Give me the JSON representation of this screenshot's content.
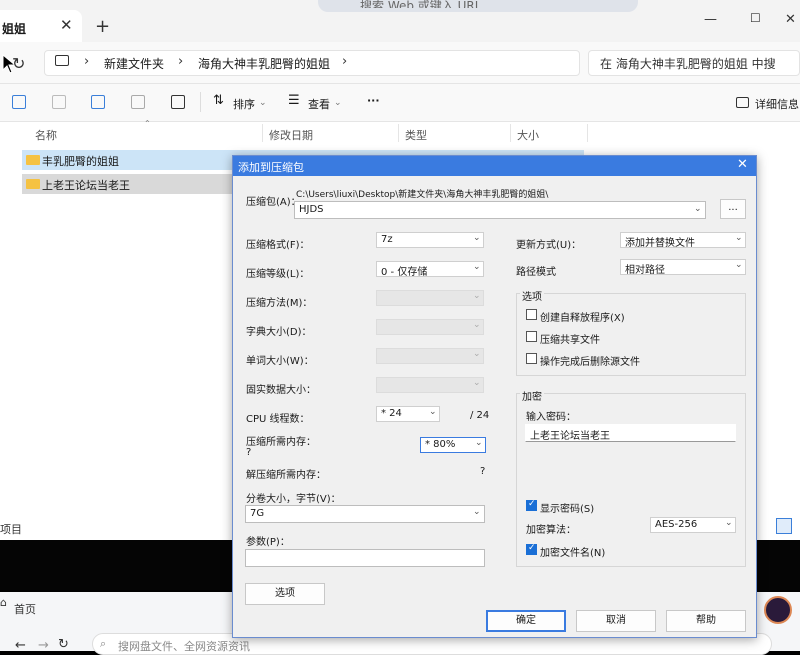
{
  "explorer": {
    "tab_title": "姐姐",
    "close_glyph": "✕",
    "new_tab_glyph": "+",
    "browser_search_placeholder": "搜索 Web 或键入 URL",
    "breadcrumb": [
      "新建文件夹",
      "海角大神丰乳肥臀的姐姐"
    ],
    "search_placeholder": "在 海角大神丰乳肥臀的姐姐 中搜",
    "toolbar": {
      "sort": "排序",
      "view": "查看",
      "more": "···",
      "details": "详细信息"
    },
    "columns": [
      "名称",
      "修改日期",
      "类型",
      "大小"
    ],
    "rows": [
      "丰乳肥臀的姐姐",
      "上老王论坛当老王"
    ],
    "status": "项目"
  },
  "browser": {
    "home_tab": "首页",
    "address_placeholder": "搜网盘文件、全网资源资讯"
  },
  "dialog": {
    "title": "添加到压缩包",
    "archive_label": "压缩包(A)：",
    "archive_path": "C:\\Users\\liuxi\\Desktop\\新建文件夹\\海角大神丰乳肥臀的姐姐\\",
    "archive_name": "HJDS",
    "browse_label": "...",
    "format_label": "压缩格式(F)：",
    "format_value": "7z",
    "level_label": "压缩等级(L)：",
    "level_value": "0 - 仅存储",
    "method_label": "压缩方法(M)：",
    "dict_label": "字典大小(D)：",
    "word_label": "单词大小(W)：",
    "solid_label": "固实数据大小：",
    "cpu_label": "CPU 线程数：",
    "cpu_value": "* 24",
    "cpu_total": "/ 24",
    "mem_label": "压缩所需内存：",
    "mem_q": "?",
    "mem_value": "* 80%",
    "decomp_label": "解压缩所需内存：",
    "decomp_q": "?",
    "split_label": "分卷大小，字节(V)：",
    "split_value": "7G",
    "params_label": "参数(P)：",
    "params_value": "",
    "options_button": "选项",
    "update_label": "更新方式(U)：",
    "update_value": "添加并替换文件",
    "path_label": "路径模式",
    "path_value": "相对路径",
    "options_group": "选项",
    "opt_sfx": "创建自释放程序(X)",
    "opt_shared": "压缩共享文件",
    "opt_delete": "操作完成后删除源文件",
    "encrypt_group": "加密",
    "password_label": "输入密码：",
    "password_value": "上老王论坛当老王",
    "show_password": "显示密码(S)",
    "enc_method_label": "加密算法：",
    "enc_method_value": "AES-256",
    "encrypt_names": "加密文件名(N)",
    "ok_button": "确定",
    "cancel_button": "取消",
    "help_button": "帮助"
  }
}
